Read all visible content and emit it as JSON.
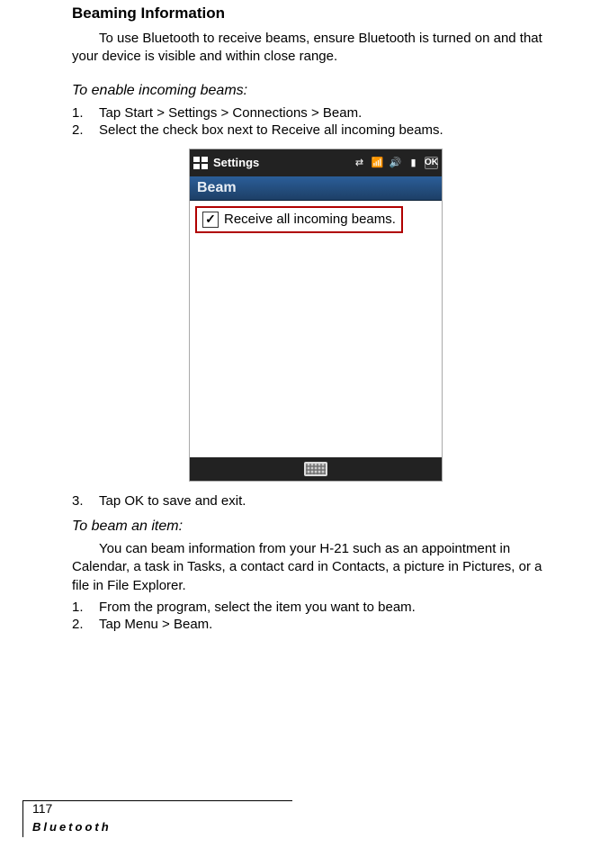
{
  "heading": "Beaming Information",
  "intro": "To use Bluetooth to receive beams, ensure Bluetooth is turned on and that your device is visible and within close range.",
  "section1": {
    "title": "To enable incoming beams:",
    "steps_a": [
      {
        "num": "1.",
        "text": "Tap Start > Settings > Connections > Beam."
      },
      {
        "num": "2.",
        "text": "Select the check box next to Receive all incoming beams."
      }
    ],
    "steps_b": [
      {
        "num": "3.",
        "text": "Tap OK to save and exit."
      }
    ]
  },
  "screenshot": {
    "titlebar_label": "Settings",
    "ok_label": "OK",
    "subtitle": "Beam",
    "checkbox_label": "Receive all incoming beams.",
    "checkbox_checked": "✓"
  },
  "section2": {
    "title": "To beam an item:",
    "para": "You can beam information from your H-21 such as an appointment in Calendar, a task in Tasks, a contact card in Contacts, a picture in Pictures, or a file in File Explorer.",
    "steps": [
      {
        "num": "1.",
        "text": "From the program, select the item you want to beam."
      },
      {
        "num": "2.",
        "text": "Tap Menu > Beam."
      }
    ]
  },
  "footer": {
    "page": "117",
    "chapter": "Bluetooth"
  }
}
